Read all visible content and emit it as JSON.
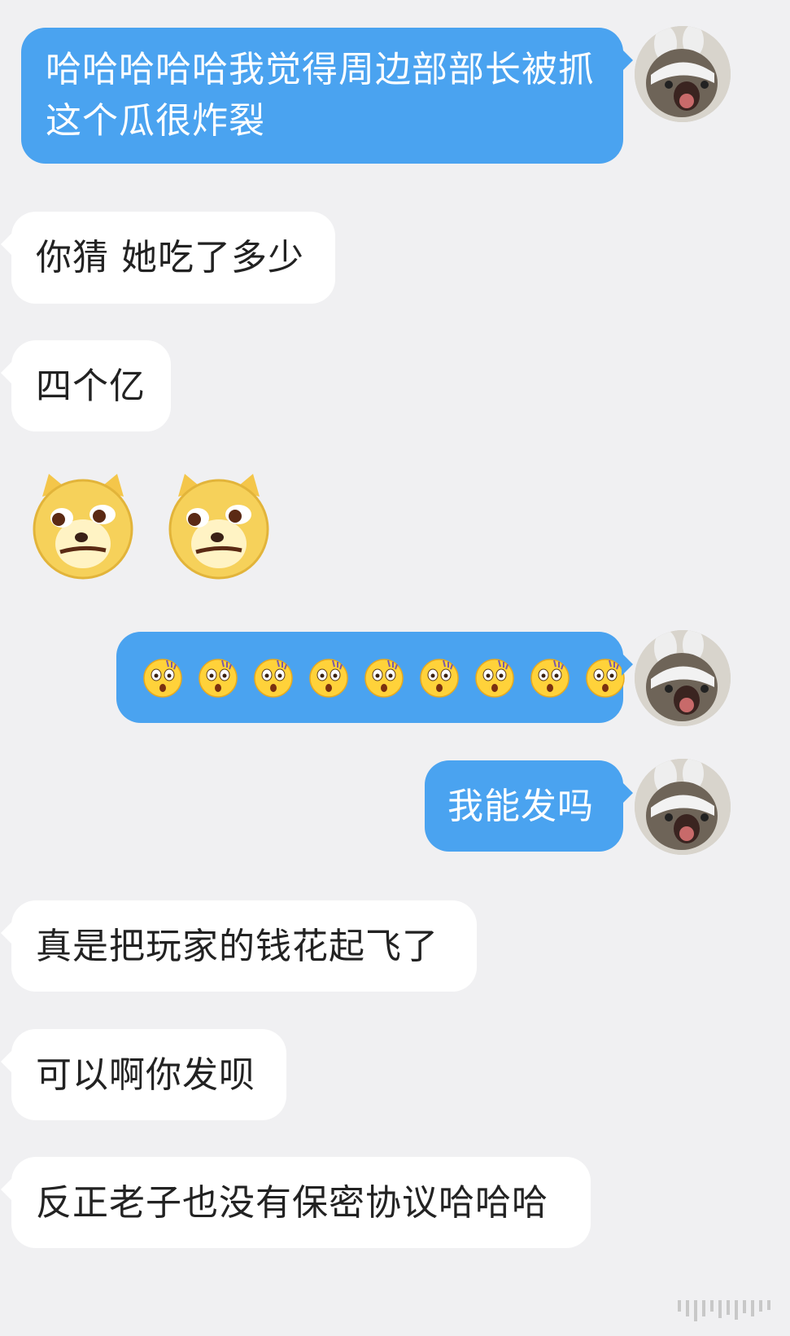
{
  "messages": [
    {
      "side": "out",
      "text": "哈哈哈哈哈我觉得周边部部长被抓这个瓜很炸裂"
    },
    {
      "side": "in",
      "text": "你猜 她吃了多少"
    },
    {
      "side": "in",
      "text": "四个亿"
    },
    {
      "side": "in",
      "stickers": [
        "doge-emoji",
        "doge-emoji"
      ]
    },
    {
      "side": "out",
      "emoji": "shocked-face-emoji",
      "emoji_count": 9
    },
    {
      "side": "out",
      "text": "我能发吗"
    },
    {
      "side": "in",
      "text": "真是把玩家的钱花起飞了"
    },
    {
      "side": "in",
      "text": "可以啊你发呗"
    },
    {
      "side": "in",
      "text": "反正老子也没有保密协议哈哈哈"
    }
  ],
  "colors": {
    "background": "#f0f0f2",
    "outgoing_bubble": "#4aa3f0",
    "incoming_bubble": "#ffffff",
    "outgoing_text": "#ffffff",
    "incoming_text": "#222222"
  },
  "icons": {
    "avatar": "cat-with-bunny-hat-avatar",
    "sticker": "doge-emoji",
    "reaction": "shocked-face-emoji"
  }
}
